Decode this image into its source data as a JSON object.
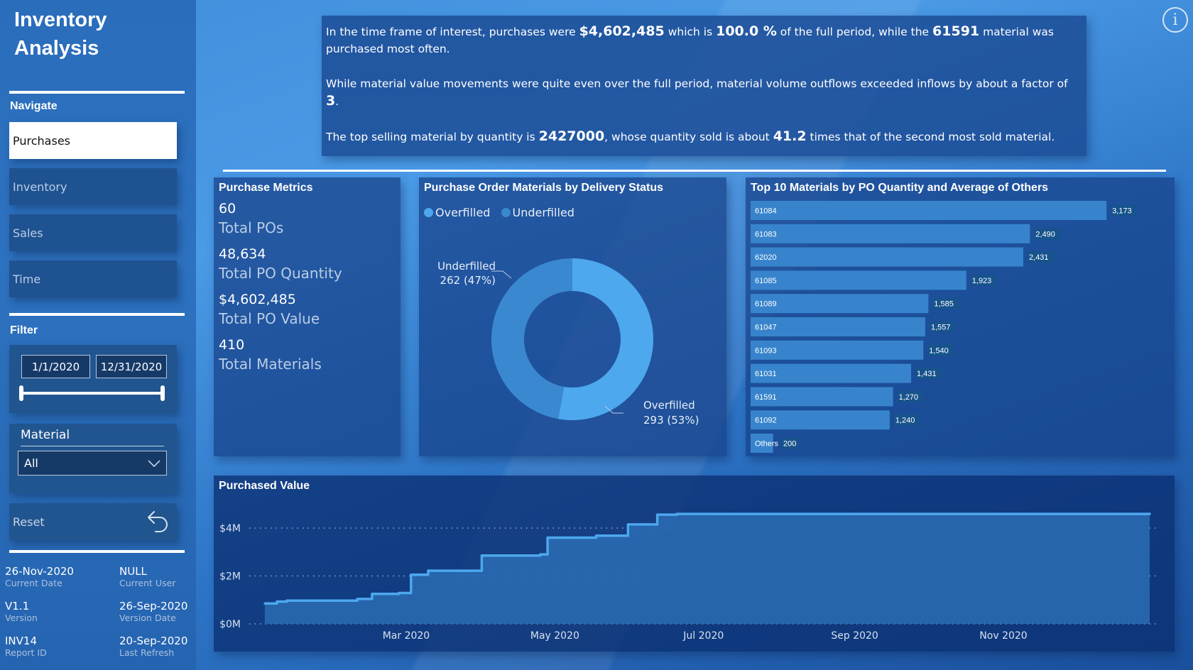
{
  "app": {
    "title_line1": "Inventory",
    "title_line2": "Analysis"
  },
  "sidebar": {
    "navigate_label": "Navigate",
    "nav_items": [
      {
        "label": "Purchases",
        "active": true
      },
      {
        "label": "Inventory",
        "active": false
      },
      {
        "label": "Sales",
        "active": false
      },
      {
        "label": "Time",
        "active": false
      }
    ],
    "filter_label": "Filter",
    "date_range": {
      "start": "1/1/2020",
      "end": "12/31/2020"
    },
    "material": {
      "label": "Material",
      "selected": "All"
    },
    "reset_label": "Reset",
    "info": [
      {
        "value": "26-Nov-2020",
        "label": "Current Date"
      },
      {
        "value": "NULL",
        "label": "Current User"
      },
      {
        "value": "V1.1",
        "label": "Version"
      },
      {
        "value": "26-Sep-2020",
        "label": "Version Date"
      },
      {
        "value": "INV14",
        "label": "Report ID"
      },
      {
        "value": "20-Sep-2020",
        "label": "Last Refresh"
      }
    ]
  },
  "narrative": {
    "p1_a": "In the time frame of interest, purchases were ",
    "p1_value": "$4,602,485",
    "p1_b": " which is ",
    "p1_pct": "100.0 %",
    "p1_c": " of the full period, while the ",
    "p1_material": "61591",
    "p1_d": " material was purchased most often.",
    "p2_a": "While material value movements were quite even over the full period, material volume outflows exceeded inflows by about a factor of ",
    "p2_factor": "3",
    "p2_b": ".",
    "p3_a": "The top selling material by quantity is ",
    "p3_material": "2427000",
    "p3_b": ", whose quantity sold is about ",
    "p3_ratio": "41.2",
    "p3_c": " times that of the second most sold material."
  },
  "metrics": {
    "title": "Purchase Metrics",
    "items": [
      {
        "value": "60",
        "label": "Total POs"
      },
      {
        "value": "48,634",
        "label": "Total PO Quantity"
      },
      {
        "value": "$4,602,485",
        "label": "Total PO Value"
      },
      {
        "value": "410",
        "label": "Total Materials"
      }
    ]
  },
  "colors": {
    "overfilled": "#4da8ee",
    "underfilled": "#3a88d0",
    "bar": "#3784cc",
    "line": "#4da8ee"
  },
  "chart_data": [
    {
      "type": "pie",
      "variant": "donut",
      "title": "Purchase Order Materials by Delivery Status",
      "legend": [
        "Overfilled",
        "Underfilled"
      ],
      "legend_position": "top-left",
      "slices": [
        {
          "label": "Overfilled",
          "value": 293,
          "percent": "53%",
          "data_label": "293 (53%)"
        },
        {
          "label": "Underfilled",
          "value": 262,
          "percent": "47%",
          "data_label": "262 (47%)"
        }
      ]
    },
    {
      "type": "bar",
      "orientation": "horizontal",
      "title": "Top 10 Materials by PO Quantity and Average of Others",
      "categories": [
        "61084",
        "61083",
        "62020",
        "61085",
        "61089",
        "61047",
        "61093",
        "61031",
        "61591",
        "61092",
        "Others"
      ],
      "values": [
        3173,
        2490,
        2431,
        1923,
        1585,
        1557,
        1540,
        1431,
        1270,
        1240,
        200
      ],
      "value_labels": [
        "3,173",
        "2,490",
        "2,431",
        "1,923",
        "1,585",
        "1,557",
        "1,540",
        "1,431",
        "1,270",
        "1,240",
        "200"
      ],
      "xlim": [
        0,
        3450
      ]
    },
    {
      "type": "area",
      "step": true,
      "title": "Purchased Value",
      "xlabel": "",
      "ylabel": "",
      "ylim": [
        0,
        4600000
      ],
      "y_ticks": [
        0,
        2000000,
        4000000
      ],
      "y_tick_labels": [
        "$0M",
        "$2M",
        "$4M"
      ],
      "x_range": [
        "2020-01-01",
        "2020-12-31"
      ],
      "x_ticks": [
        "2020-03-01",
        "2020-05-01",
        "2020-07-01",
        "2020-09-01",
        "2020-11-01"
      ],
      "x_tick_labels": [
        "Mar 2020",
        "May 2020",
        "Jul 2020",
        "Sep 2020",
        "Nov 2020"
      ],
      "grid": true,
      "points": [
        {
          "x": "2020-01-03",
          "y": 850000
        },
        {
          "x": "2020-01-08",
          "y": 930000
        },
        {
          "x": "2020-01-12",
          "y": 970000
        },
        {
          "x": "2020-02-10",
          "y": 1040000
        },
        {
          "x": "2020-02-16",
          "y": 1250000
        },
        {
          "x": "2020-02-27",
          "y": 1290000
        },
        {
          "x": "2020-03-03",
          "y": 2050000
        },
        {
          "x": "2020-03-10",
          "y": 2220000
        },
        {
          "x": "2020-04-01",
          "y": 2850000
        },
        {
          "x": "2020-04-25",
          "y": 2900000
        },
        {
          "x": "2020-04-28",
          "y": 3600000
        },
        {
          "x": "2020-05-18",
          "y": 3680000
        },
        {
          "x": "2020-05-31",
          "y": 4150000
        },
        {
          "x": "2020-06-12",
          "y": 4560000
        },
        {
          "x": "2020-06-20",
          "y": 4590000
        },
        {
          "x": "2020-12-31",
          "y": 4602485
        }
      ]
    }
  ]
}
